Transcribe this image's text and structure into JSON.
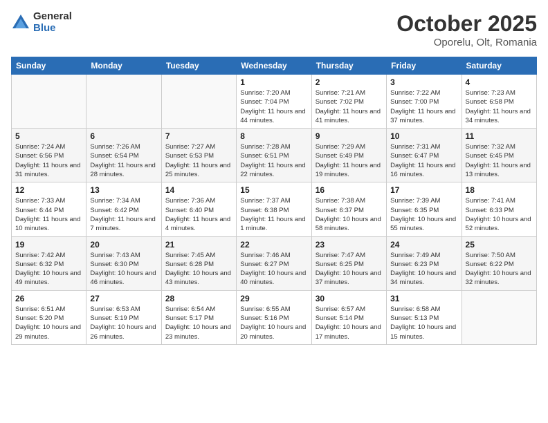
{
  "header": {
    "logo_general": "General",
    "logo_blue": "Blue",
    "title": "October 2025",
    "subtitle": "Oporelu, Olt, Romania"
  },
  "days_of_week": [
    "Sunday",
    "Monday",
    "Tuesday",
    "Wednesday",
    "Thursday",
    "Friday",
    "Saturday"
  ],
  "weeks": [
    [
      {
        "day": "",
        "sunrise": "",
        "sunset": "",
        "daylight": ""
      },
      {
        "day": "",
        "sunrise": "",
        "sunset": "",
        "daylight": ""
      },
      {
        "day": "",
        "sunrise": "",
        "sunset": "",
        "daylight": ""
      },
      {
        "day": "1",
        "sunrise": "Sunrise: 7:20 AM",
        "sunset": "Sunset: 7:04 PM",
        "daylight": "Daylight: 11 hours and 44 minutes."
      },
      {
        "day": "2",
        "sunrise": "Sunrise: 7:21 AM",
        "sunset": "Sunset: 7:02 PM",
        "daylight": "Daylight: 11 hours and 41 minutes."
      },
      {
        "day": "3",
        "sunrise": "Sunrise: 7:22 AM",
        "sunset": "Sunset: 7:00 PM",
        "daylight": "Daylight: 11 hours and 37 minutes."
      },
      {
        "day": "4",
        "sunrise": "Sunrise: 7:23 AM",
        "sunset": "Sunset: 6:58 PM",
        "daylight": "Daylight: 11 hours and 34 minutes."
      }
    ],
    [
      {
        "day": "5",
        "sunrise": "Sunrise: 7:24 AM",
        "sunset": "Sunset: 6:56 PM",
        "daylight": "Daylight: 11 hours and 31 minutes."
      },
      {
        "day": "6",
        "sunrise": "Sunrise: 7:26 AM",
        "sunset": "Sunset: 6:54 PM",
        "daylight": "Daylight: 11 hours and 28 minutes."
      },
      {
        "day": "7",
        "sunrise": "Sunrise: 7:27 AM",
        "sunset": "Sunset: 6:53 PM",
        "daylight": "Daylight: 11 hours and 25 minutes."
      },
      {
        "day": "8",
        "sunrise": "Sunrise: 7:28 AM",
        "sunset": "Sunset: 6:51 PM",
        "daylight": "Daylight: 11 hours and 22 minutes."
      },
      {
        "day": "9",
        "sunrise": "Sunrise: 7:29 AM",
        "sunset": "Sunset: 6:49 PM",
        "daylight": "Daylight: 11 hours and 19 minutes."
      },
      {
        "day": "10",
        "sunrise": "Sunrise: 7:31 AM",
        "sunset": "Sunset: 6:47 PM",
        "daylight": "Daylight: 11 hours and 16 minutes."
      },
      {
        "day": "11",
        "sunrise": "Sunrise: 7:32 AM",
        "sunset": "Sunset: 6:45 PM",
        "daylight": "Daylight: 11 hours and 13 minutes."
      }
    ],
    [
      {
        "day": "12",
        "sunrise": "Sunrise: 7:33 AM",
        "sunset": "Sunset: 6:44 PM",
        "daylight": "Daylight: 11 hours and 10 minutes."
      },
      {
        "day": "13",
        "sunrise": "Sunrise: 7:34 AM",
        "sunset": "Sunset: 6:42 PM",
        "daylight": "Daylight: 11 hours and 7 minutes."
      },
      {
        "day": "14",
        "sunrise": "Sunrise: 7:36 AM",
        "sunset": "Sunset: 6:40 PM",
        "daylight": "Daylight: 11 hours and 4 minutes."
      },
      {
        "day": "15",
        "sunrise": "Sunrise: 7:37 AM",
        "sunset": "Sunset: 6:38 PM",
        "daylight": "Daylight: 11 hours and 1 minute."
      },
      {
        "day": "16",
        "sunrise": "Sunrise: 7:38 AM",
        "sunset": "Sunset: 6:37 PM",
        "daylight": "Daylight: 10 hours and 58 minutes."
      },
      {
        "day": "17",
        "sunrise": "Sunrise: 7:39 AM",
        "sunset": "Sunset: 6:35 PM",
        "daylight": "Daylight: 10 hours and 55 minutes."
      },
      {
        "day": "18",
        "sunrise": "Sunrise: 7:41 AM",
        "sunset": "Sunset: 6:33 PM",
        "daylight": "Daylight: 10 hours and 52 minutes."
      }
    ],
    [
      {
        "day": "19",
        "sunrise": "Sunrise: 7:42 AM",
        "sunset": "Sunset: 6:32 PM",
        "daylight": "Daylight: 10 hours and 49 minutes."
      },
      {
        "day": "20",
        "sunrise": "Sunrise: 7:43 AM",
        "sunset": "Sunset: 6:30 PM",
        "daylight": "Daylight: 10 hours and 46 minutes."
      },
      {
        "day": "21",
        "sunrise": "Sunrise: 7:45 AM",
        "sunset": "Sunset: 6:28 PM",
        "daylight": "Daylight: 10 hours and 43 minutes."
      },
      {
        "day": "22",
        "sunrise": "Sunrise: 7:46 AM",
        "sunset": "Sunset: 6:27 PM",
        "daylight": "Daylight: 10 hours and 40 minutes."
      },
      {
        "day": "23",
        "sunrise": "Sunrise: 7:47 AM",
        "sunset": "Sunset: 6:25 PM",
        "daylight": "Daylight: 10 hours and 37 minutes."
      },
      {
        "day": "24",
        "sunrise": "Sunrise: 7:49 AM",
        "sunset": "Sunset: 6:23 PM",
        "daylight": "Daylight: 10 hours and 34 minutes."
      },
      {
        "day": "25",
        "sunrise": "Sunrise: 7:50 AM",
        "sunset": "Sunset: 6:22 PM",
        "daylight": "Daylight: 10 hours and 32 minutes."
      }
    ],
    [
      {
        "day": "26",
        "sunrise": "Sunrise: 6:51 AM",
        "sunset": "Sunset: 5:20 PM",
        "daylight": "Daylight: 10 hours and 29 minutes."
      },
      {
        "day": "27",
        "sunrise": "Sunrise: 6:53 AM",
        "sunset": "Sunset: 5:19 PM",
        "daylight": "Daylight: 10 hours and 26 minutes."
      },
      {
        "day": "28",
        "sunrise": "Sunrise: 6:54 AM",
        "sunset": "Sunset: 5:17 PM",
        "daylight": "Daylight: 10 hours and 23 minutes."
      },
      {
        "day": "29",
        "sunrise": "Sunrise: 6:55 AM",
        "sunset": "Sunset: 5:16 PM",
        "daylight": "Daylight: 10 hours and 20 minutes."
      },
      {
        "day": "30",
        "sunrise": "Sunrise: 6:57 AM",
        "sunset": "Sunset: 5:14 PM",
        "daylight": "Daylight: 10 hours and 17 minutes."
      },
      {
        "day": "31",
        "sunrise": "Sunrise: 6:58 AM",
        "sunset": "Sunset: 5:13 PM",
        "daylight": "Daylight: 10 hours and 15 minutes."
      },
      {
        "day": "",
        "sunrise": "",
        "sunset": "",
        "daylight": ""
      }
    ]
  ]
}
